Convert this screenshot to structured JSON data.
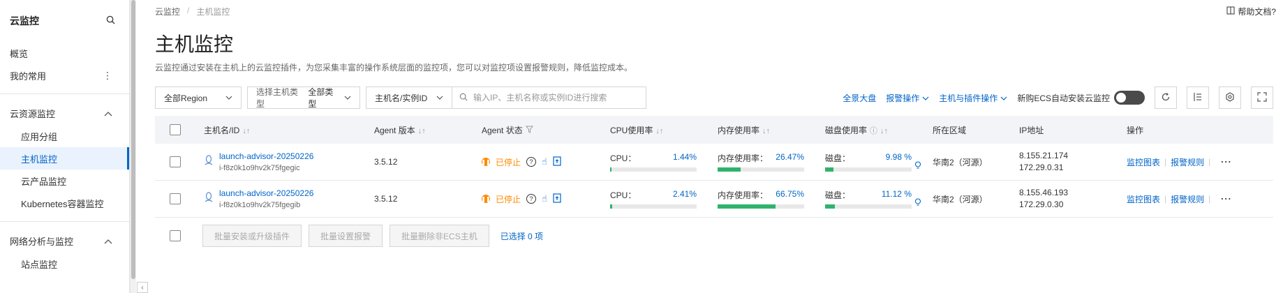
{
  "sidebar": {
    "title": "云监控",
    "items_top": [
      {
        "label": "概览"
      },
      {
        "label": "我的常用"
      }
    ],
    "group1": {
      "label": "云资源监控",
      "items": [
        {
          "label": "应用分组"
        },
        {
          "label": "主机监控"
        },
        {
          "label": "云产品监控"
        },
        {
          "label": "Kubernetes容器监控"
        }
      ]
    },
    "group2": {
      "label": "网络分析与监控",
      "items": [
        {
          "label": "站点监控"
        }
      ]
    }
  },
  "header": {
    "breadcrumb": [
      "云监控",
      "主机监控"
    ],
    "breadcrumb_sep": "/",
    "help": "帮助文档?",
    "title": "主机监控",
    "description": "云监控通过安装在主机上的云监控插件，为您采集丰富的操作系统层面的监控项，您可以对监控项设置报警规则，降低监控成本。"
  },
  "toolbar": {
    "region": "全部Region",
    "host_type_placeholder": "选择主机类型",
    "host_type_value": "全部类型",
    "search_field": "主机名/实例ID",
    "search_placeholder": "输入IP、主机名称或实例ID进行搜索",
    "links": [
      "全景大盘",
      "报警操作",
      "主机与插件操作"
    ],
    "auto_install_label": "新购ECS自动安装云监控"
  },
  "table": {
    "headers": {
      "name": "主机名/ID",
      "agent": "Agent 版本",
      "state": "Agent 状态",
      "cpu": "CPU使用率",
      "mem": "内存使用率",
      "disk": "磁盘使用率",
      "region": "所在区域",
      "ip": "IP地址",
      "op": "操作"
    },
    "rows": [
      {
        "name": "launch-advisor-20250226",
        "id": "i-f8z0k1o9hv2k75fgegic",
        "agent": "3.5.12",
        "state": "已停止",
        "cpu_label": "CPU：",
        "cpu": "1.44%",
        "cpu_pct": 1.44,
        "mem_label": "内存使用率：",
        "mem": "26.47%",
        "mem_pct": 26.47,
        "disk_label": "磁盘：",
        "disk": "9.98 %",
        "disk_pct": 9.98,
        "region": "华南2（河源）",
        "ip1": "8.155.21.174",
        "ip2": "172.29.0.31",
        "op1": "监控图表",
        "op2": "报警规则"
      },
      {
        "name": "launch-advisor-20250226",
        "id": "i-f8z0k1o9hv2k75fgegib",
        "agent": "3.5.12",
        "state": "已停止",
        "cpu_label": "CPU：",
        "cpu": "2.41%",
        "cpu_pct": 2.41,
        "mem_label": "内存使用率：",
        "mem": "66.75%",
        "mem_pct": 66.75,
        "disk_label": "磁盘：",
        "disk": "11.12 %",
        "disk_pct": 11.12,
        "region": "华南2（河源）",
        "ip1": "8.155.46.193",
        "ip2": "172.29.0.30",
        "op1": "监控图表",
        "op2": "报警规则"
      }
    ]
  },
  "footer": {
    "btn1": "批量安装或升级插件",
    "btn2": "批量设置报警",
    "btn3": "批量删除非ECS主机",
    "selected": "已选择 0 项"
  },
  "colors": {
    "accent": "#0064c8",
    "warning": "#ff8a00",
    "progress": "#2fb36c"
  }
}
